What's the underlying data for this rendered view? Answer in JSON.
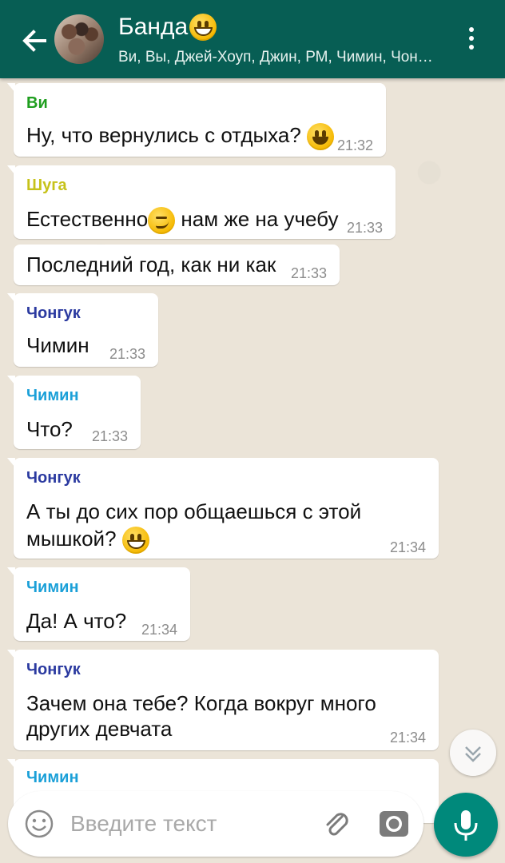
{
  "header": {
    "title": "Банда",
    "subtitle": "Ви, Вы, Джей-Хоуп, Джин, РМ, Чимин, Чонгук, Шуга"
  },
  "messages": [
    {
      "sender": "Ви",
      "text": "Ну, что вернулись с отдыха?",
      "time": "21:32",
      "sender_color": "#1f9e1f"
    },
    {
      "sender": "Шуга",
      "text1": "Естественно",
      "text2": " нам же на учебу",
      "time": "21:33",
      "sender_color": "#c6c21a"
    },
    {
      "text": "Последний год, как ни как",
      "time": "21:33"
    },
    {
      "sender": "Чонгук",
      "text": "Чимин",
      "time": "21:33",
      "sender_color": "#2b3aa0"
    },
    {
      "sender": "Чимин",
      "text": "Что?",
      "time": "21:33",
      "sender_color": "#1ba0d8"
    },
    {
      "sender": "Чонгук",
      "line1": "А ты до сих пор общаешься с этой",
      "line2": "мышкой?",
      "time": "21:34",
      "sender_color": "#2b3aa0"
    },
    {
      "sender": "Чимин",
      "text": "Да! А что?",
      "time": "21:34",
      "sender_color": "#1ba0d8"
    },
    {
      "sender": "Чонгук",
      "line1": "Зачем она тебе? Когда вокруг много",
      "line2": "других девчата",
      "time": "21:34",
      "sender_color": "#2b3aa0"
    },
    {
      "sender": "Чимин",
      "sender_color": "#1ba0d8"
    }
  ],
  "input": {
    "placeholder": "Введите текст"
  },
  "icons": {
    "back": "arrow-left-icon",
    "menu": "more-vertical-icon",
    "emoji": "smiley-icon",
    "attach": "paperclip-icon",
    "camera": "camera-icon",
    "mic": "microphone-icon",
    "scroll": "chevrons-down-icon"
  },
  "colors": {
    "header": "#075e54",
    "mic_button": "#00897b"
  }
}
